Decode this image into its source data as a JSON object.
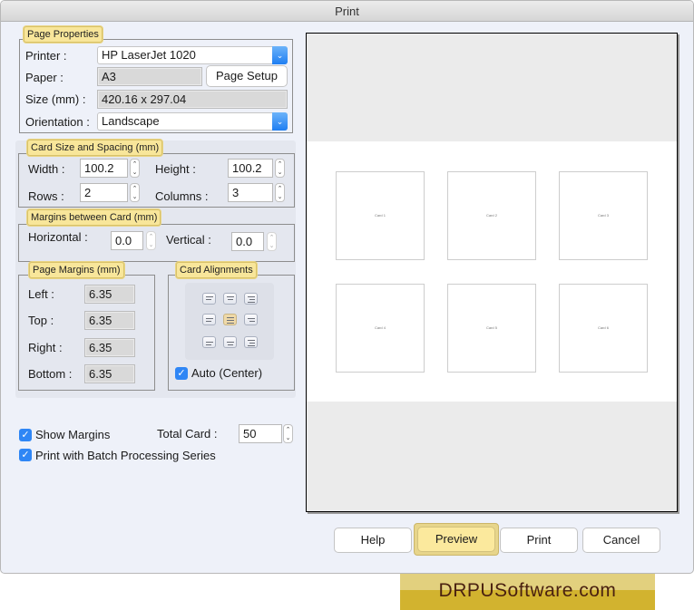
{
  "window": {
    "title": "Print"
  },
  "page_properties": {
    "legend": "Page Properties",
    "printer_label": "Printer :",
    "printer_value": "HP LaserJet 1020",
    "paper_label": "Paper :",
    "paper_value": "A3",
    "page_setup_button": "Page Setup",
    "size_label": "Size (mm) :",
    "size_value": "420.16 x 297.04",
    "orientation_label": "Orientation :",
    "orientation_value": "Landscape"
  },
  "card_size": {
    "legend": "Card Size and Spacing (mm)",
    "width_label": "Width :",
    "width_value": "100.2",
    "height_label": "Height :",
    "height_value": "100.2",
    "rows_label": "Rows :",
    "rows_value": "2",
    "columns_label": "Columns :",
    "columns_value": "3"
  },
  "margins_between": {
    "legend": "Margins between Card (mm)",
    "horizontal_label": "Horizontal :",
    "horizontal_value": "0.0",
    "vertical_label": "Vertical :",
    "vertical_value": "0.0"
  },
  "page_margins": {
    "legend": "Page Margins (mm)",
    "left_label": "Left :",
    "left_value": "6.35",
    "top_label": "Top :",
    "top_value": "6.35",
    "right_label": "Right :",
    "right_value": "6.35",
    "bottom_label": "Bottom :",
    "bottom_value": "6.35"
  },
  "card_alignments": {
    "legend": "Card Alignments",
    "selected": "middle-center",
    "auto_center_label": "Auto (Center)",
    "auto_center_checked": true
  },
  "options": {
    "show_margins_label": "Show Margins",
    "show_margins_checked": true,
    "batch_label": "Print with Batch Processing Series",
    "batch_checked": true,
    "total_card_label": "Total Card :",
    "total_card_value": "50"
  },
  "preview": {
    "cards": [
      "Card 1",
      "Card 2",
      "Card 3",
      "Card 4",
      "Card 5",
      "Card 6"
    ]
  },
  "buttons": {
    "help": "Help",
    "preview": "Preview",
    "print": "Print",
    "cancel": "Cancel"
  },
  "brand": {
    "text": "DRPUSoftware.com"
  },
  "icons": {
    "caret": "chevron-down-icon",
    "stepper": "up-down-arrows-icon",
    "check": "checkmark-icon"
  }
}
